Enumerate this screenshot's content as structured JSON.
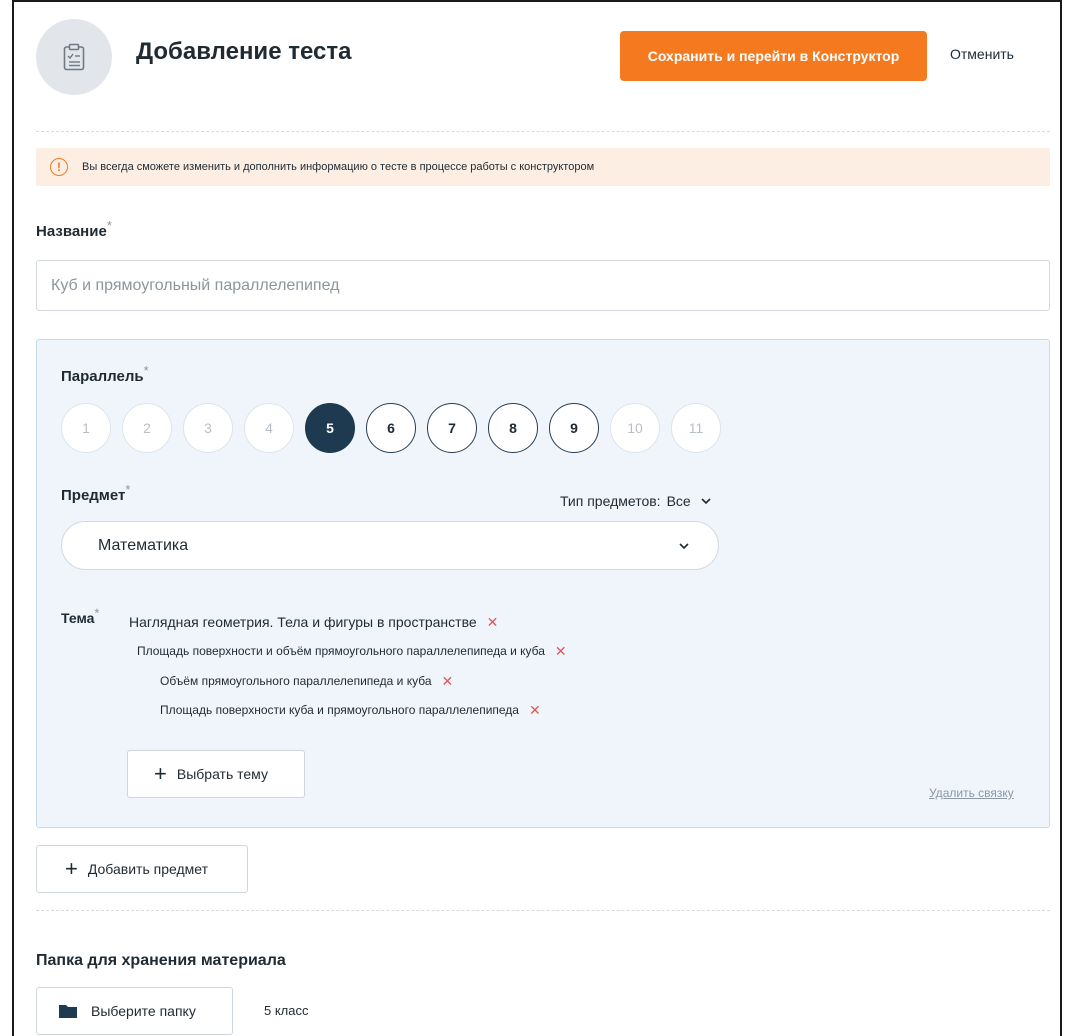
{
  "header": {
    "title": "Добавление теста",
    "save_label": "Сохранить и перейти в Конструктор",
    "cancel_label": "Отменить"
  },
  "notice": {
    "text": "Вы всегда сможете изменить и дополнить информацию о тесте в процессе работы с конструктором"
  },
  "name_field": {
    "label": "Название",
    "required_mark": "*",
    "placeholder": "Куб и прямоугольный параллелепипед"
  },
  "grade": {
    "label": "Параллель",
    "required_mark": "*",
    "options": [
      "1",
      "2",
      "3",
      "4",
      "5",
      "6",
      "7",
      "8",
      "9",
      "10",
      "11"
    ],
    "selected": "5",
    "enabled": [
      "5",
      "6",
      "7",
      "8",
      "9"
    ]
  },
  "subject": {
    "label": "Предмет",
    "required_mark": "*",
    "type_label": "Тип предметов:",
    "type_value": "Все",
    "selected": "Математика"
  },
  "topics": {
    "label": "Тема",
    "required_mark": "*",
    "items": [
      "Наглядная геометрия. Тела и фигуры в пространстве",
      "Площадь поверхности и объём прямоугольного параллелепипеда и куба",
      "Объём прямоугольного параллелепипеда и куба",
      "Площадь поверхности куба и прямоугольного параллелепипеда"
    ],
    "choose_label": "Выбрать тему",
    "unlink_label": "Удалить связку"
  },
  "add_subject_label": "Добавить предмет",
  "folder": {
    "label": "Папка для хранения материала",
    "button_label": "Выберите папку",
    "value": "5 класс"
  },
  "colors": {
    "accent": "#f57a1f",
    "active_grade": "#1d3a50",
    "notice_bg": "#fdeee3",
    "panel_bg": "#eff5fb",
    "remove": "#e05858"
  }
}
